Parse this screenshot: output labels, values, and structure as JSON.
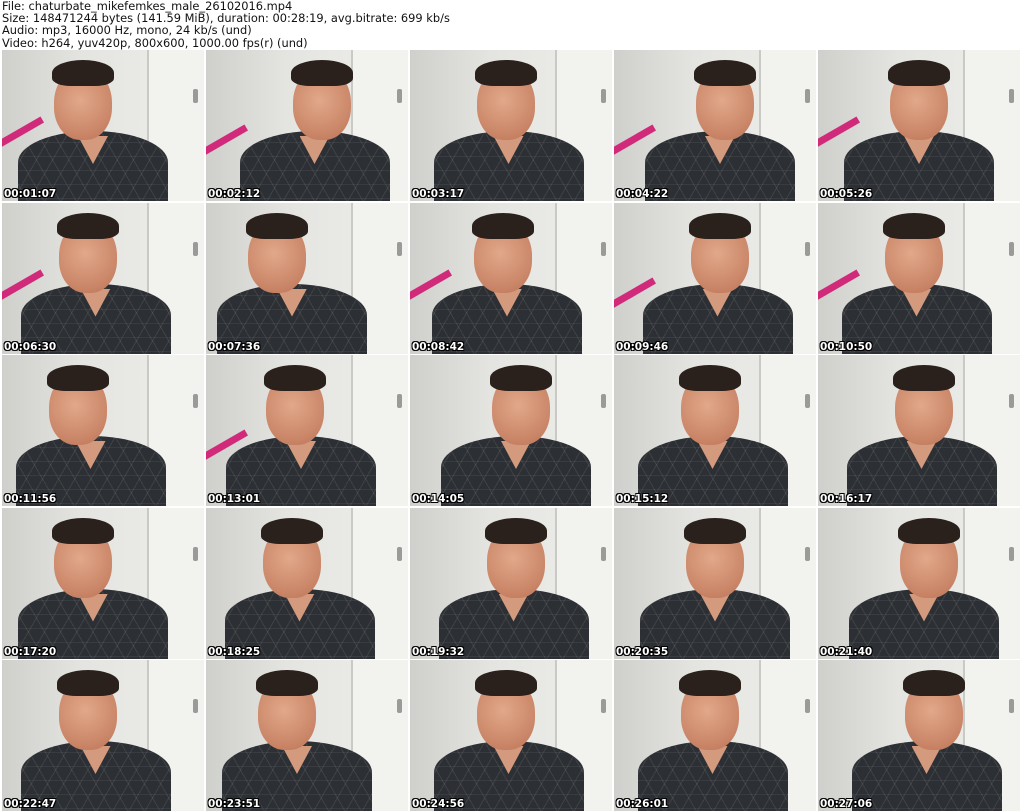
{
  "header": {
    "file_line": "File: chaturbate_mikefemkes_male_26102016.mp4",
    "size_line": "Size: 148471244 bytes (141.59 MiB), duration: 00:28:19, avg.bitrate: 699 kb/s",
    "audio_line": "Audio: mp3, 16000 Hz, mono, 24 kb/s (und)",
    "video_line": "Video: h264, yuv420p, 800x600, 1000.00 fps(r) (und)"
  },
  "thumbnails": [
    {
      "timestamp": "00:01:07"
    },
    {
      "timestamp": "00:02:12"
    },
    {
      "timestamp": "00:03:17"
    },
    {
      "timestamp": "00:04:22"
    },
    {
      "timestamp": "00:05:26"
    },
    {
      "timestamp": "00:06:30"
    },
    {
      "timestamp": "00:07:36"
    },
    {
      "timestamp": "00:08:42"
    },
    {
      "timestamp": "00:09:46"
    },
    {
      "timestamp": "00:10:50"
    },
    {
      "timestamp": "00:11:56"
    },
    {
      "timestamp": "00:13:01"
    },
    {
      "timestamp": "00:14:05"
    },
    {
      "timestamp": "00:15:12"
    },
    {
      "timestamp": "00:16:17"
    },
    {
      "timestamp": "00:17:20"
    },
    {
      "timestamp": "00:18:25"
    },
    {
      "timestamp": "00:19:32"
    },
    {
      "timestamp": "00:20:35"
    },
    {
      "timestamp": "00:21:40"
    },
    {
      "timestamp": "00:22:47"
    },
    {
      "timestamp": "00:23:51"
    },
    {
      "timestamp": "00:24:56"
    },
    {
      "timestamp": "00:26:01"
    },
    {
      "timestamp": "00:27:06"
    }
  ],
  "colors": {
    "accent_pink": "#d12a7b",
    "shirt": "#2c2f33",
    "timestamp_text": "#ffffff"
  }
}
